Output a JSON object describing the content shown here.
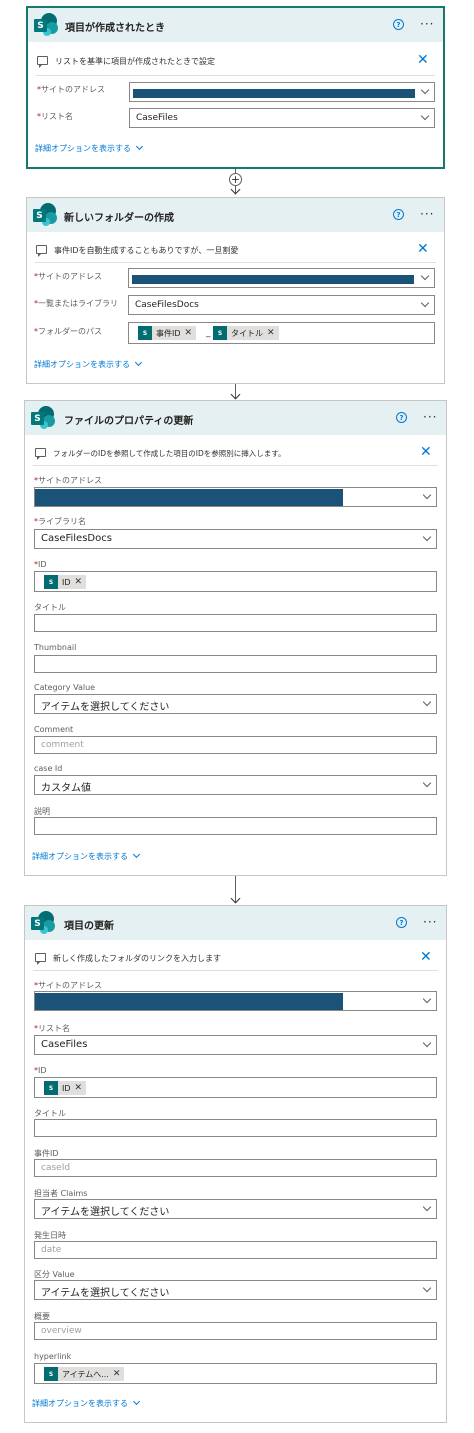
{
  "card1": {
    "title": "項目が作成されたとき",
    "comment": "リストを基準に項目が作成されたときで設定",
    "site_label": "サイトのアドレス",
    "list_label": "リスト名",
    "list_value": "CaseFiles",
    "advanced": "詳細オプションを表示する"
  },
  "card2": {
    "title": "新しいフォルダーの作成",
    "comment": "事件IDを自動生成することもありですが、一旦割愛",
    "site_label": "サイトのアドレス",
    "library_label": "一覧またはライブラリ",
    "library_value": "CaseFilesDocs",
    "path_label": "フォルダーのパス",
    "token_case_id": "事件ID",
    "path_separator": "_",
    "token_title": "タイトル",
    "advanced": "詳細オプションを表示する"
  },
  "card3": {
    "title": "ファイルのプロパティの更新",
    "comment": "フォルダーのIDを参照して作成した項目のIDを参照別に挿入します。",
    "site_label": "サイトのアドレス",
    "library_label": "ライブラリ名",
    "library_value": "CaseFilesDocs",
    "id_label": "ID",
    "id_token": "ID",
    "title_label": "タイトル",
    "thumbnail_label": "Thumbnail",
    "category_label": "Category Value",
    "category_value": "アイテムを選択してください",
    "comment_label": "Comment",
    "comment_placeholder": "comment",
    "caseid_label": "case Id",
    "caseid_value": "カスタム値",
    "desc_label": "説明",
    "advanced": "詳細オプションを表示する"
  },
  "card4": {
    "title": "項目の更新",
    "comment": "新しく作成したフォルダのリンクを入力します",
    "site_label": "サイトのアドレス",
    "list_label": "リスト名",
    "list_value": "CaseFiles",
    "id_label": "ID",
    "id_token": "ID",
    "title_label": "タイトル",
    "caseid_label": "事件ID",
    "caseid_placeholder": "caseId",
    "assignee_label": "担当者 Claims",
    "assignee_value": "アイテムを選択してください",
    "date_label": "発生日時",
    "date_placeholder": "date",
    "category_label": "区分 Value",
    "category_value": "アイテムを選択してください",
    "overview_label": "概要",
    "overview_placeholder": "overview",
    "hyperlink_label": "hyperlink",
    "hyperlink_token": "アイテムへ...",
    "advanced": "詳細オプションを表示する"
  },
  "common": {
    "required_mark": "*",
    "sp_letter": "S",
    "help_glyph": "?",
    "more_glyph": "···",
    "close_glyph": "✕",
    "token_remove": "✕",
    "plus_glyph": "+"
  },
  "colors": {
    "accent": "#0078d4",
    "header_bg": "#e5f0f2",
    "selected_border": "#16796f",
    "sharepoint_teal": "#036c70",
    "redaction": "#1b5277",
    "required": "#a4262c"
  }
}
